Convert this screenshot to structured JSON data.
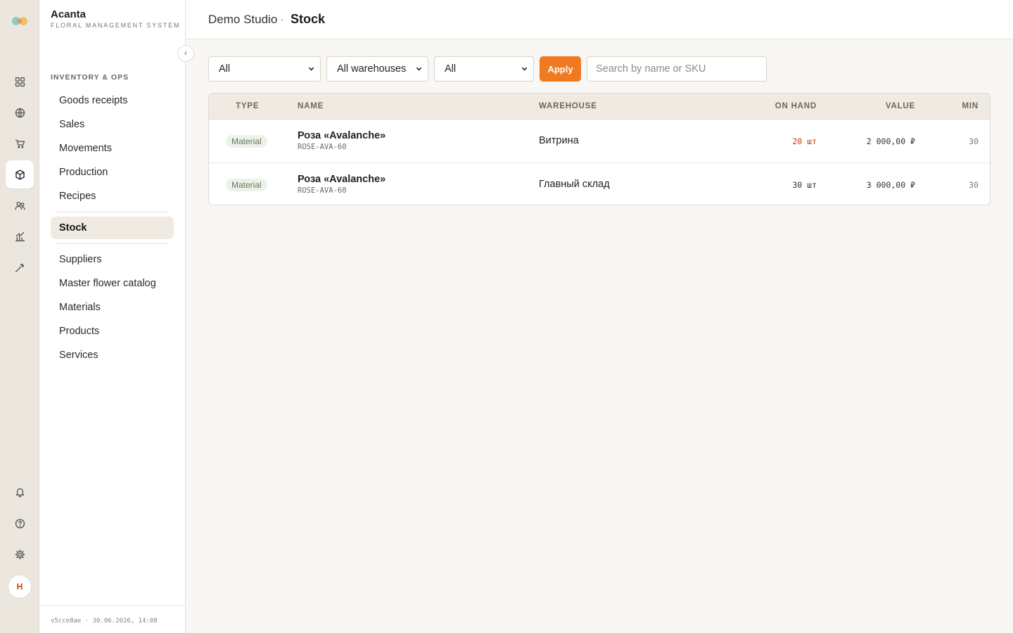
{
  "brand": {
    "name": "Acanta",
    "subtitle": "FLORAL MANAGEMENT SYSTEM"
  },
  "rail": {
    "icons": [
      "dashboard-icon",
      "globe-icon",
      "cart-icon",
      "box-icon",
      "users-icon",
      "chart-icon",
      "tools-icon"
    ],
    "bottom_icons": [
      "bell-icon",
      "help-icon",
      "gear-icon"
    ],
    "avatar_initial": "H",
    "active": "box-icon"
  },
  "sidebar": {
    "section_title": "INVENTORY & OPS",
    "items": [
      {
        "label": "Goods receipts"
      },
      {
        "label": "Sales"
      },
      {
        "label": "Movements"
      },
      {
        "label": "Production"
      },
      {
        "label": "Recipes"
      },
      {
        "label": "Stock"
      },
      {
        "label": "Suppliers"
      },
      {
        "label": "Master flower catalog"
      },
      {
        "label": "Materials"
      },
      {
        "label": "Products"
      },
      {
        "label": "Services"
      }
    ],
    "active_item": "Stock",
    "footer": "v5cce8ae · 30.06.2026, 14:08"
  },
  "header": {
    "org": "Demo Studio",
    "separator": "·",
    "page": "Stock"
  },
  "filters": {
    "type_value": "All",
    "warehouse_value": "All warehouses",
    "status_value": "All",
    "apply_label": "Apply",
    "search_placeholder": "Search by name or SKU"
  },
  "table": {
    "columns": [
      "TYPE",
      "NAME",
      "WAREHOUSE",
      "ON HAND",
      "VALUE",
      "MIN"
    ],
    "rows": [
      {
        "type": "Material",
        "name": "Роза «Avalanche»",
        "sku": "ROSE-AVA-60",
        "warehouse": "Витрина",
        "on_hand": "20 шт",
        "value": "2 000,00 ₽",
        "min": "30",
        "low_stock": true
      },
      {
        "type": "Material",
        "name": "Роза «Avalanche»",
        "sku": "ROSE-AVA-60",
        "warehouse": "Главный склад",
        "on_hand": "30 шт",
        "value": "3 000,00 ₽",
        "min": "30",
        "low_stock": false
      }
    ]
  },
  "colors": {
    "accent": "#f07a22",
    "low_stock": "#c2410c",
    "badge_text": "#5e7a5a",
    "badge_bg": "#eef1ea"
  }
}
